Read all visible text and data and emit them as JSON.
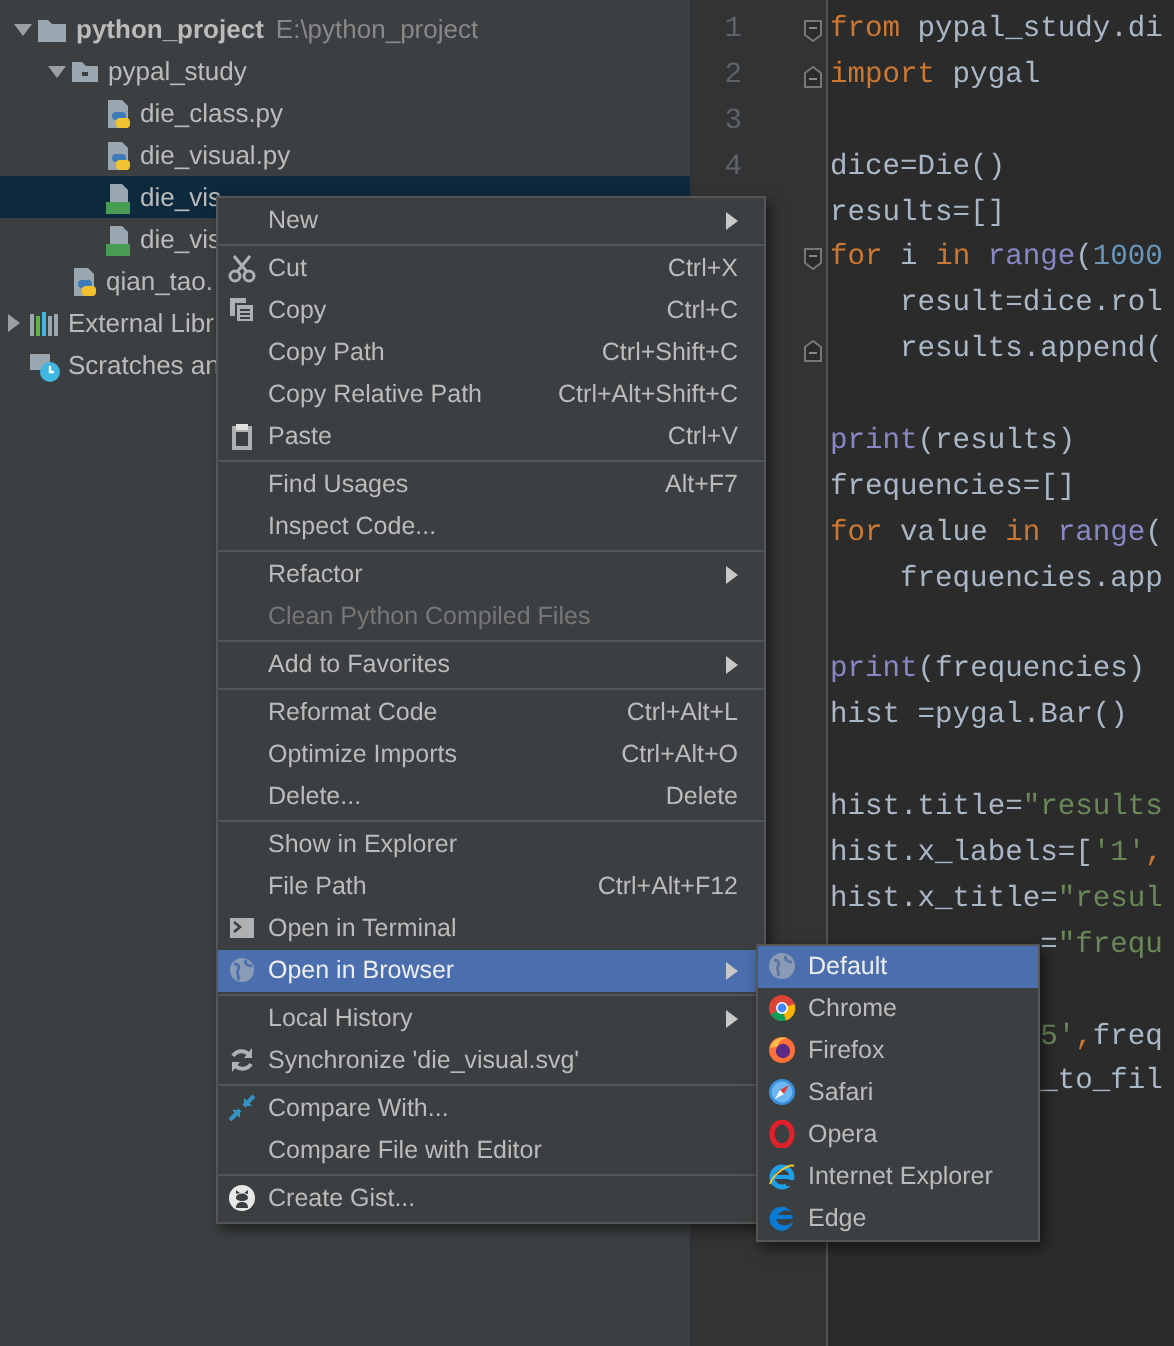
{
  "project_tree": [
    {
      "label": "python_project",
      "path": "E:\\python_project",
      "kind": "project",
      "expanded": true,
      "selected": false,
      "children": [
        {
          "label": "pypal_study",
          "kind": "folder",
          "expanded": true,
          "selected": false,
          "children": [
            {
              "label": "die_class.py",
              "kind": "python",
              "selected": false
            },
            {
              "label": "die_visual.py",
              "kind": "python",
              "selected": false
            },
            {
              "label": "die_vis",
              "kind": "html",
              "selected": true
            },
            {
              "label": "die_vis",
              "kind": "html",
              "selected": false
            }
          ]
        },
        {
          "label": "qian_tao.",
          "kind": "python",
          "selected": false
        }
      ]
    },
    {
      "label": "External Libr",
      "kind": "libraries",
      "expanded": false,
      "selected": false
    },
    {
      "label": "Scratches an",
      "kind": "scratches",
      "selected": false
    }
  ],
  "editor": {
    "lines": [
      {
        "number": "1",
        "fold_start": true,
        "tokens": [
          {
            "kind": "keyword",
            "text": "from"
          },
          {
            "kind": "plain",
            "text": " pypal_study.di"
          }
        ]
      },
      {
        "number": "2",
        "fold_end": true,
        "tokens": [
          {
            "kind": "keyword",
            "text": "import"
          },
          {
            "kind": "plain",
            "text": " pygal"
          }
        ]
      },
      {
        "number": "3"
      },
      {
        "number": "4",
        "tokens": [
          {
            "kind": "plain",
            "text": "dice=Die()"
          }
        ]
      },
      {
        "tokens": [
          {
            "kind": "plain",
            "text": "results=[]"
          }
        ]
      },
      {
        "fold_start": true,
        "tokens": [
          {
            "kind": "keyword",
            "text": "for"
          },
          {
            "kind": "plain",
            "text": " i "
          },
          {
            "kind": "keyword",
            "text": "in "
          },
          {
            "kind": "builtin",
            "text": "range"
          },
          {
            "kind": "plain",
            "text": "("
          },
          {
            "kind": "number",
            "text": "1000"
          }
        ]
      },
      {
        "tokens": [
          {
            "kind": "plain",
            "text": "    result=dice.rol"
          }
        ]
      },
      {
        "fold_end": true,
        "tokens": [
          {
            "kind": "plain",
            "text": "    results.append("
          }
        ]
      },
      {
        "blank_line_before": true,
        "tokens": [
          {
            "kind": "builtin",
            "text": "print"
          },
          {
            "kind": "plain",
            "text": "(results)"
          }
        ]
      },
      {
        "tokens": [
          {
            "kind": "plain",
            "text": "frequencies=[]"
          }
        ]
      },
      {
        "tokens": [
          {
            "kind": "keyword",
            "text": "for"
          },
          {
            "kind": "plain",
            "text": " value "
          },
          {
            "kind": "keyword",
            "text": "in "
          },
          {
            "kind": "builtin",
            "text": "range"
          },
          {
            "kind": "plain",
            "text": "("
          }
        ]
      },
      {
        "tokens": [
          {
            "kind": "plain",
            "text": "    frequencies.app"
          }
        ]
      },
      {
        "blank_line_before": true,
        "tokens": [
          {
            "kind": "builtin",
            "text": "print"
          },
          {
            "kind": "plain",
            "text": "(frequencies)"
          }
        ]
      },
      {
        "tokens": [
          {
            "kind": "plain",
            "text": "hist =pygal.Bar()"
          }
        ]
      },
      {
        "blank_line_before": true,
        "tokens": [
          {
            "kind": "plain",
            "text": "hist.title="
          },
          {
            "kind": "string",
            "text": "\"results"
          }
        ]
      },
      {
        "tokens": [
          {
            "kind": "plain",
            "text": "hist.x_labels=["
          },
          {
            "kind": "string",
            "text": "'1'"
          },
          {
            "kind": "delimiter",
            "text": ","
          }
        ]
      },
      {
        "tokens": [
          {
            "kind": "plain",
            "text": "hist.x_title="
          },
          {
            "kind": "string",
            "text": "\"resul"
          }
        ]
      },
      {
        "tokens": [
          {
            "kind": "plain",
            "text": "            ="
          },
          {
            "kind": "string",
            "text": "\"frequ"
          }
        ]
      },
      {
        "blank_line_before": true,
        "tokens": [
          {
            "kind": "string",
            "text": "            5'"
          },
          {
            "kind": "delimiter",
            "text": ","
          },
          {
            "kind": "plain",
            "text": "freq"
          }
        ]
      },
      {
        "tokens": [
          {
            "kind": "plain",
            "text": "            _to_fil"
          }
        ]
      }
    ]
  },
  "context_menu": [
    {
      "kind": "item",
      "label": "New",
      "submenu": true,
      "disabled": false,
      "selected": false
    },
    {
      "kind": "separator"
    },
    {
      "kind": "item",
      "label": "Cut",
      "shortcut": "Ctrl+X",
      "submenu": false,
      "disabled": false,
      "selected": false
    },
    {
      "kind": "item",
      "label": "Copy",
      "shortcut": "Ctrl+C",
      "submenu": false,
      "disabled": false,
      "selected": false
    },
    {
      "kind": "item",
      "label": "Copy Path",
      "shortcut": "Ctrl+Shift+C",
      "submenu": false,
      "disabled": false,
      "selected": false
    },
    {
      "kind": "item",
      "label": "Copy Relative Path",
      "shortcut": "Ctrl+Alt+Shift+C",
      "submenu": false,
      "disabled": false,
      "selected": false
    },
    {
      "kind": "item",
      "label": "Paste",
      "shortcut": "Ctrl+V",
      "submenu": false,
      "disabled": false,
      "selected": false
    },
    {
      "kind": "separator"
    },
    {
      "kind": "item",
      "label": "Find Usages",
      "shortcut": "Alt+F7",
      "submenu": false,
      "disabled": false,
      "selected": false
    },
    {
      "kind": "item",
      "label": "Inspect Code...",
      "submenu": false,
      "disabled": false,
      "selected": false
    },
    {
      "kind": "separator"
    },
    {
      "kind": "item",
      "label": "Refactor",
      "submenu": true,
      "disabled": false,
      "selected": false
    },
    {
      "kind": "item",
      "label": "Clean Python Compiled Files",
      "submenu": false,
      "disabled": true,
      "selected": false
    },
    {
      "kind": "separator"
    },
    {
      "kind": "item",
      "label": "Add to Favorites",
      "submenu": true,
      "disabled": false,
      "selected": false
    },
    {
      "kind": "separator"
    },
    {
      "kind": "item",
      "label": "Reformat Code",
      "shortcut": "Ctrl+Alt+L",
      "submenu": false,
      "disabled": false,
      "selected": false
    },
    {
      "kind": "item",
      "label": "Optimize Imports",
      "shortcut": "Ctrl+Alt+O",
      "submenu": false,
      "disabled": false,
      "selected": false
    },
    {
      "kind": "item",
      "label": "Delete...",
      "shortcut": "Delete",
      "submenu": false,
      "disabled": false,
      "selected": false
    },
    {
      "kind": "separator"
    },
    {
      "kind": "item",
      "label": "Show in Explorer",
      "submenu": false,
      "disabled": false,
      "selected": false
    },
    {
      "kind": "item",
      "label": "File Path",
      "shortcut": "Ctrl+Alt+F12",
      "submenu": false,
      "disabled": false,
      "selected": false
    },
    {
      "kind": "item",
      "label": "Open in Terminal",
      "submenu": false,
      "disabled": false,
      "selected": false
    },
    {
      "kind": "item",
      "label": "Open in Browser",
      "submenu": true,
      "disabled": false,
      "selected": true
    },
    {
      "kind": "separator"
    },
    {
      "kind": "item",
      "label": "Local History",
      "submenu": true,
      "disabled": false,
      "selected": false
    },
    {
      "kind": "item",
      "label": "Synchronize 'die_visual.svg'",
      "submenu": false,
      "disabled": false,
      "selected": false
    },
    {
      "kind": "separator"
    },
    {
      "kind": "item",
      "label": "Compare With...",
      "submenu": false,
      "disabled": false,
      "selected": false
    },
    {
      "kind": "item",
      "label": "Compare File with Editor",
      "submenu": false,
      "disabled": false,
      "selected": false
    },
    {
      "kind": "separator"
    },
    {
      "kind": "item",
      "label": "Create Gist...",
      "submenu": false,
      "disabled": false,
      "selected": false
    }
  ],
  "browser_submenu": [
    {
      "label": "Default",
      "selected": true
    },
    {
      "label": "Chrome",
      "selected": false
    },
    {
      "label": "Firefox",
      "selected": false
    },
    {
      "label": "Safari",
      "selected": false
    },
    {
      "label": "Opera",
      "selected": false
    },
    {
      "label": "Internet Explorer",
      "selected": false
    },
    {
      "label": "Edge",
      "selected": false
    }
  ]
}
